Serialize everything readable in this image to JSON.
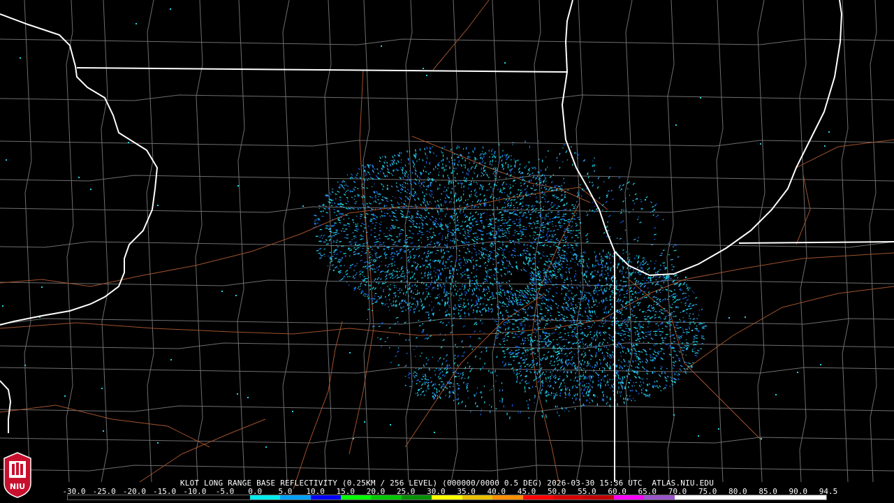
{
  "caption": {
    "text": "KLOT LONG RANGE BASE REFLECTIVITY (0.25KM / 256 LEVEL) (000000/0000 0.5 DEG) 2026-03-30 15:36 UTC  ATLAS.NIU.EDU"
  },
  "logo": {
    "text": "NIU"
  },
  "scale": {
    "labels": [
      "-30.0",
      "-25.0",
      "-20.0",
      "-15.0",
      "-10.0",
      "-5.0",
      "0.0",
      "5.0",
      "10.0",
      "15.0",
      "20.0",
      "25.0",
      "30.0",
      "35.0",
      "40.0",
      "45.0",
      "50.0",
      "55.0",
      "60.0",
      "65.0",
      "70.0",
      "75.0",
      "80.0",
      "85.0",
      "90.0",
      "94.5"
    ],
    "colors": [
      "#000000",
      "#000000",
      "#000000",
      "#000000",
      "#000000",
      "#000000",
      "#00ecec",
      "#01a0f6",
      "#0000f6",
      "#00ff00",
      "#00c800",
      "#009000",
      "#ffff00",
      "#e7c000",
      "#ff9000",
      "#ff0000",
      "#d60000",
      "#c00000",
      "#ff00ff",
      "#9955c9",
      "#ffffff",
      "#ffffff",
      "#ffffff",
      "#ffffff",
      "#ffffff"
    ]
  },
  "colors": {
    "background": "#000000",
    "state_border": "#ffffff",
    "county_line": "#6e6e6e",
    "highway": "#a0522d",
    "echo_light": "#1fd6e6",
    "echo_mid": "#3aa0f0",
    "echo_strong": "#1560e0"
  }
}
